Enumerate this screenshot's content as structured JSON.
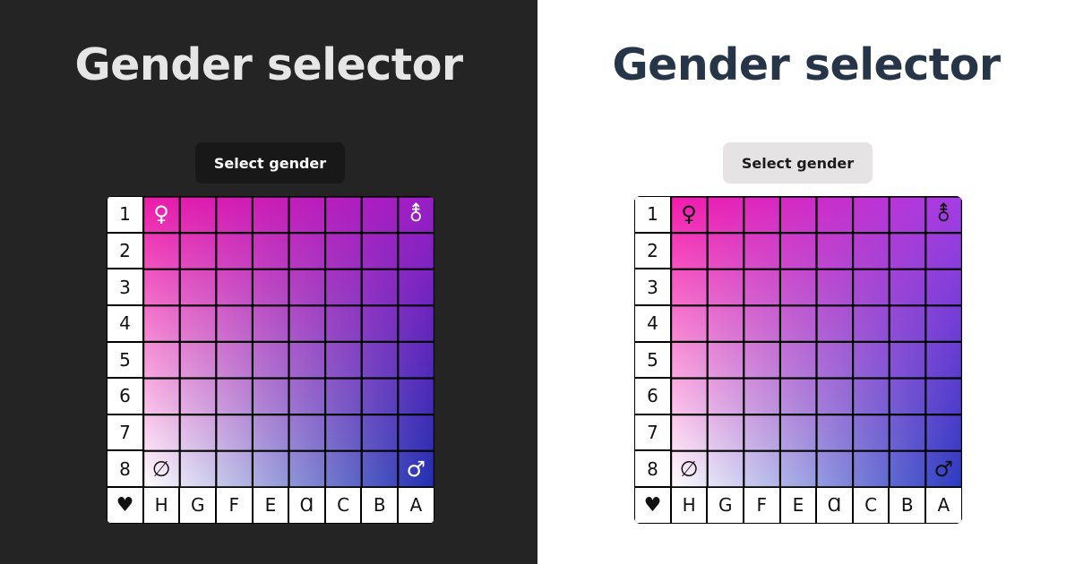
{
  "panels": [
    {
      "theme": "dark",
      "title": "Gender selector",
      "button_label": "Select gender",
      "colors": {
        "background": "#242424",
        "title": "#e6e6e6",
        "button_bg": "#181818",
        "button_text": "#ffffff",
        "symbol_top_left": "#ffffff",
        "symbol_top_right": "#ffffff",
        "symbol_bottom_left": "#111111",
        "symbol_bottom_right": "#ffffff"
      },
      "gradient": {
        "top_left": "#ee1aaa",
        "top_right": "#9a1ec8",
        "bottom_left": "#ffffff",
        "bottom_right": "#1f2fb0"
      }
    },
    {
      "theme": "light",
      "title": "Gender selector",
      "button_label": "Select gender",
      "colors": {
        "background": "#ffffff",
        "title": "#263548",
        "button_bg": "#e5e3e3",
        "button_text": "#1c1c1c",
        "symbol_top_left": "#111111",
        "symbol_top_right": "#111111",
        "symbol_bottom_left": "#111111",
        "symbol_bottom_right": "#111111"
      },
      "gradient": {
        "top_left": "#f51aac",
        "top_right": "#a63ee6",
        "bottom_left": "#ffffff",
        "bottom_right": "#2a3ac0"
      }
    }
  ],
  "grid": {
    "row_labels": [
      "1",
      "2",
      "3",
      "4",
      "5",
      "6",
      "7",
      "8"
    ],
    "column_labels": [
      "H",
      "G",
      "F",
      "E",
      "Ɑ",
      "C",
      "B",
      "A"
    ],
    "corner_label": "♥",
    "symbols": {
      "top_left": "♀",
      "top_right": "⚨",
      "bottom_left": "∅",
      "bottom_right": "♂"
    },
    "symbol_icons": {
      "top_left": "female-sign-icon",
      "top_right": "androgyne-sign-icon",
      "bottom_left": "empty-set-icon",
      "bottom_right": "male-sign-icon"
    }
  }
}
